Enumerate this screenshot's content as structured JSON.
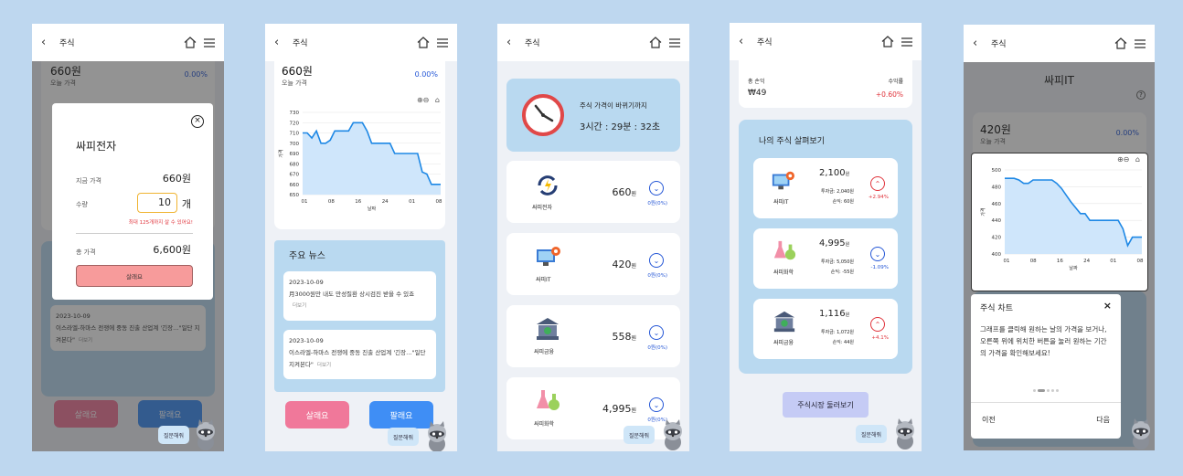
{
  "header": {
    "title": "주식"
  },
  "help_label": "질문해줘",
  "screen1": {
    "price": "660원",
    "price_caption": "오늘 가격",
    "pct": "0.00%",
    "modal": {
      "title": "싸피전자",
      "current_label": "지금 가격",
      "current_value": "660원",
      "qty_label": "수량",
      "qty_value": "10",
      "qty_unit": "개",
      "qty_hint": "최대 125개까지 살 수 있어요!",
      "total_label": "총 가격",
      "total_value": "6,600원",
      "confirm": "살래요"
    },
    "news_date": "2023-10-09",
    "news_text": "이스라엘-하마스 전쟁에 중동 진출 산업계 '긴장…\"일단 지켜본다\"",
    "more": "더보기",
    "buy": "살래요",
    "sell": "팔래요"
  },
  "screen2": {
    "price": "660원",
    "price_caption": "오늘 가격",
    "pct": "0.00%",
    "y_axis_label": "가격",
    "x_axis_label": "날짜",
    "news_title": "주요 뉴스",
    "news": [
      {
        "date": "2023-10-09",
        "text": "月3000원만 내도 만성질환 상시검진 받을 수 있죠"
      },
      {
        "date": "2023-10-09",
        "text": "이스라엘-하마스 전쟁에 중동 진출 산업계 '긴장…\"일단 지켜본다\""
      }
    ],
    "more": "더보기",
    "buy": "살래요",
    "sell": "팔래요"
  },
  "screen3": {
    "timer_title": "주식 가격이 바뀌기까지",
    "hours": "3시간",
    "minutes": "29분",
    "seconds": "32초",
    "stocks": [
      {
        "name": "싸피전자",
        "price": "660",
        "unit": "원",
        "change": "0원(0%)"
      },
      {
        "name": "싸피IT",
        "price": "420",
        "unit": "원",
        "change": "0원(0%)"
      },
      {
        "name": "싸피금융",
        "price": "558",
        "unit": "원",
        "change": "0원(0%)"
      },
      {
        "name": "싸피화학",
        "price": "4,995",
        "unit": "원",
        "change": "0원(0%)"
      }
    ]
  },
  "screen4": {
    "total_profit_label": "총 손익",
    "total_profit_value": "₩49",
    "return_label": "수익률",
    "return_value": "+0.60%",
    "my_stocks_title": "나의 주식 살펴보기",
    "holdings": [
      {
        "name": "싸피IT",
        "price": "2,100",
        "unit": "원",
        "invest": "투자금: 2,040원",
        "profit": "손익: 60원",
        "pct": "+2.94%",
        "up": true
      },
      {
        "name": "싸피화학",
        "price": "4,995",
        "unit": "원",
        "invest": "투자금: 5,050원",
        "profit": "손익: -55원",
        "pct": "-1.09%",
        "up": false
      },
      {
        "name": "싸피금융",
        "price": "1,116",
        "unit": "원",
        "invest": "투자금: 1,072원",
        "profit": "손익: 44원",
        "pct": "+4.1%",
        "up": true
      }
    ],
    "browse": "주식시장 둘러보기"
  },
  "screen5": {
    "stock_title": "싸피IT",
    "price": "420원",
    "price_caption": "오늘 가격",
    "pct": "0.00%",
    "y_axis_label": "가격",
    "x_axis_label": "날짜",
    "tip_title": "주식 차트",
    "tip_close": "×",
    "tip_text": "그래프를 클릭해 원하는 날의 가격을 보거나, 오른쪽 위에 위치한 버튼을 눌러 원하는 기간의 가격을 확인해보세요!",
    "prev": "이전",
    "next": "다음"
  },
  "chart_data": [
    {
      "type": "area",
      "x_ticks": [
        "01",
        "08",
        "16",
        "24",
        "01",
        "08"
      ],
      "yticks": [
        650,
        660,
        670,
        680,
        690,
        700,
        710,
        720,
        730
      ],
      "ylim": [
        650,
        730
      ],
      "xlabel": "날짜",
      "ylabel": "가격",
      "values": [
        710,
        710,
        705,
        712,
        700,
        700,
        703,
        712,
        712,
        712,
        712,
        720,
        720,
        720,
        712,
        700,
        700,
        700,
        700,
        700,
        690,
        690,
        690,
        690,
        690,
        690,
        672,
        670,
        660,
        660,
        660
      ]
    },
    {
      "type": "area",
      "x_ticks": [
        "01",
        "08",
        "16",
        "24",
        "01",
        "08"
      ],
      "yticks": [
        400,
        420,
        440,
        460,
        480,
        500
      ],
      "ylim": [
        400,
        500
      ],
      "xlabel": "날짜",
      "ylabel": "가격",
      "values": [
        490,
        490,
        490,
        488,
        484,
        484,
        488,
        488,
        488,
        488,
        488,
        484,
        478,
        470,
        462,
        455,
        448,
        448,
        440,
        440,
        440,
        440,
        440,
        440,
        440,
        430,
        410,
        420,
        420,
        420
      ]
    }
  ]
}
